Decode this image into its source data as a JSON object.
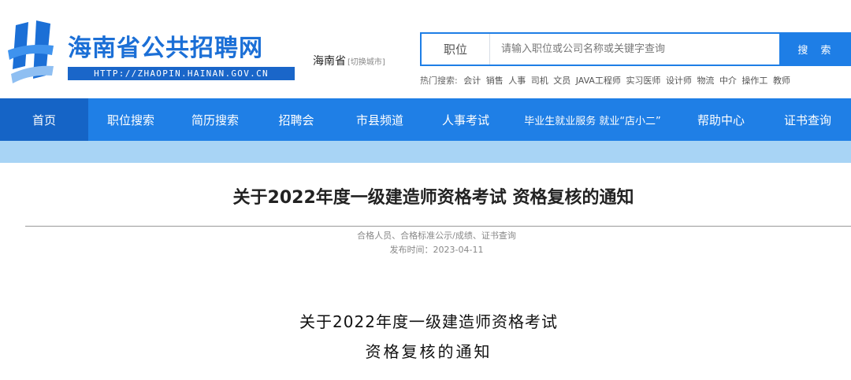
{
  "header": {
    "logo_icon": "hainan-zhaopin-logo-icon",
    "site_name": "海南省公共招聘网",
    "site_url": "HTTP://ZHAOPIN.HAINAN.GOV.CN",
    "city": "海南省",
    "city_switch": "[切换城市]"
  },
  "search": {
    "type_label": "职位",
    "placeholder": "请输入职位或公司名称或关键字查询",
    "button_label": "搜 索",
    "hot_label": "热门搜索:",
    "hot_items": [
      "会计",
      "销售",
      "人事",
      "司机",
      "文员",
      "JAVA工程师",
      "实习医师",
      "设计师",
      "物流",
      "中介",
      "操作工",
      "教师"
    ]
  },
  "nav": {
    "items": [
      {
        "label": "首页",
        "active": true
      },
      {
        "label": "职位搜索"
      },
      {
        "label": "简历搜索"
      },
      {
        "label": "招聘会"
      },
      {
        "label": "市县频道"
      },
      {
        "label": "人事考试"
      },
      {
        "label": "毕业生就业服务 就业“店小二”"
      },
      {
        "label": "帮助中心"
      },
      {
        "label": "证书查询"
      }
    ]
  },
  "article": {
    "title": "关于2022年度一级建造师资格考试 资格复核的通知",
    "category": "合格人员、合格标准公示/成绩、证书查询",
    "publish_date": "发布时间：2023-04-11",
    "body_line1": "关于2022年度一级建造师资格考试",
    "body_line2": "资格复核的通知"
  },
  "colors": {
    "brand_blue": "#1f7fe6",
    "nav_active": "#1564c6",
    "sub_bar": "#a8d4f5"
  }
}
